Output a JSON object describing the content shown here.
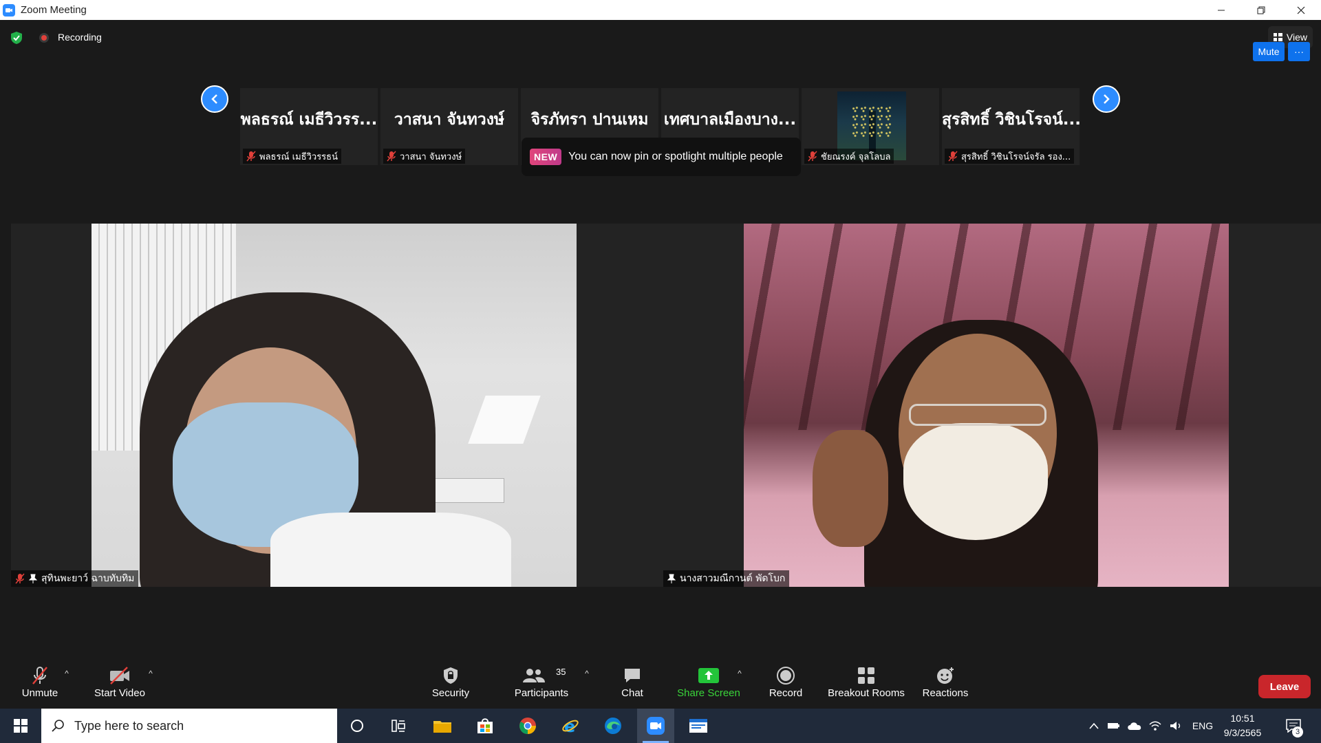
{
  "window": {
    "title": "Zoom Meeting"
  },
  "topbar": {
    "recording_label": "Recording",
    "view_label": "View"
  },
  "gallery": {
    "thumbnails": [
      {
        "display_name": "พลธรณ์ เมธีวิวรร...",
        "label": "พลธรณ์ เมธีวิวรรธน์",
        "muted": true
      },
      {
        "display_name": "วาสนา จันทวงษ์",
        "label": "วาสนา จันทวงษ์",
        "muted": true
      },
      {
        "display_name": "จิรภัทรา ปานเหม",
        "label": "",
        "muted": false
      },
      {
        "display_name": "เทศบาลเมืองบาง...",
        "label": "",
        "muted": false
      },
      {
        "display_name": "",
        "label": "ชัยณรงค์ จุลโลบล",
        "muted": true,
        "has_picture": true
      },
      {
        "display_name": "สุรสิทธิ์ วิชินโรจน์...",
        "label": "สุรสิทธิ์ วิชินโรจน์จรัล รอง...",
        "muted": true
      }
    ],
    "toast": {
      "badge": "NEW",
      "message": "You can now pin or spotlight multiple people"
    }
  },
  "videos": {
    "left": {
      "name": "สุทินพะยาว์ ฉาบทับทิม",
      "muted": true,
      "pinned": true
    },
    "right": {
      "name": "นางสาวมณีกานต์ พัดโบก",
      "muted": false,
      "pinned": true
    },
    "hover_controls": {
      "mute_label": "Mute",
      "more_label": "···"
    }
  },
  "toolbar": {
    "unmute_label": "Unmute",
    "start_video_label": "Start Video",
    "security_label": "Security",
    "participants_label": "Participants",
    "participants_count": "35",
    "chat_label": "Chat",
    "share_screen_label": "Share Screen",
    "record_label": "Record",
    "breakout_rooms_label": "Breakout Rooms",
    "reactions_label": "Reactions",
    "leave_label": "Leave",
    "colors": {
      "share_green": "#3ad43a",
      "leave_red": "#c9262b",
      "accent_blue": "#2D8CFF"
    }
  },
  "taskbar": {
    "search_placeholder": "Type here to search",
    "language": "ENG",
    "time": "10:51",
    "date": "9/3/2565",
    "notification_count": "3",
    "pinned_apps": [
      "cortana-icon",
      "task-view-icon",
      "file-explorer-icon",
      "store-icon",
      "chrome-icon",
      "ie-icon",
      "edge-icon",
      "zoom-icon",
      "app-window-icon"
    ]
  }
}
